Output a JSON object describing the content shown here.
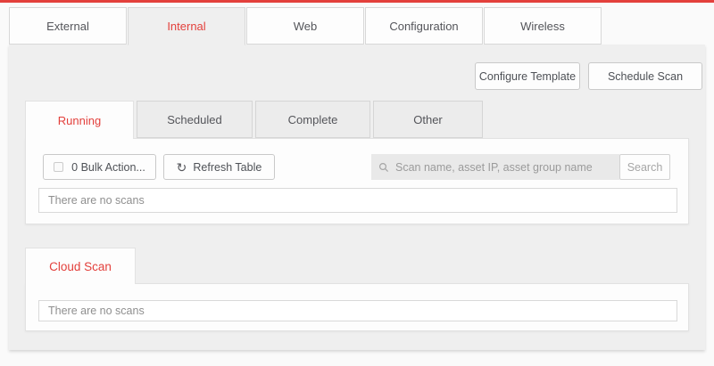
{
  "colors": {
    "accent": "#e3403c",
    "panel_bg": "#efefef"
  },
  "top_tabs": {
    "items": [
      {
        "label": "External"
      },
      {
        "label": "Internal"
      },
      {
        "label": "Web"
      },
      {
        "label": "Configuration"
      },
      {
        "label": "Wireless"
      }
    ],
    "selected": "Internal"
  },
  "actions": {
    "configure_template_label": "Configure Template",
    "schedule_scan_label": "Schedule Scan"
  },
  "scan_tabs": {
    "items": [
      {
        "label": "Running"
      },
      {
        "label": "Scheduled"
      },
      {
        "label": "Complete"
      },
      {
        "label": "Other"
      }
    ],
    "selected": "Running"
  },
  "toolbar": {
    "bulk_action_label": "0 Bulk Action...",
    "refresh_label": "Refresh Table",
    "refresh_icon": "↻",
    "search_placeholder": "Scan name, asset IP, asset group name",
    "search_button_label": "Search"
  },
  "running_section": {
    "empty_message": "There are no scans"
  },
  "cloud_scan_section": {
    "tab_label": "Cloud Scan",
    "empty_message": "There are no scans"
  }
}
